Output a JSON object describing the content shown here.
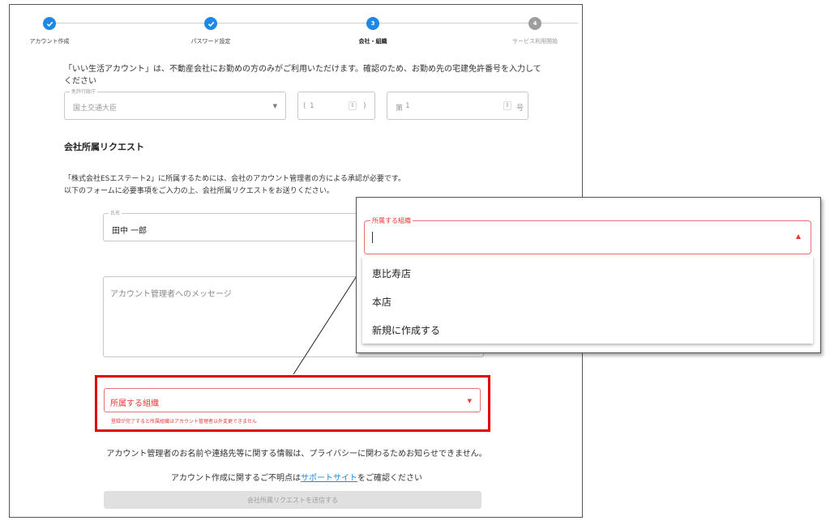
{
  "stepper": {
    "steps": [
      {
        "number": "1",
        "label": "アカウント作成",
        "state": "done"
      },
      {
        "number": "2",
        "label": "パスワード設定",
        "state": "done"
      },
      {
        "number": "3",
        "label": "会社・組織",
        "state": "active"
      },
      {
        "number": "4",
        "label": "サービス利用開始",
        "state": "todo"
      }
    ]
  },
  "intro": {
    "text": "「いい生活アカウント」は、不動産会社にお勤めの方のみがご利用いただけます。確認のため、お勤め先の宅建免許番号を入力してください"
  },
  "license": {
    "issuer_legend": "免許行政庁",
    "issuer_value": "国土交通大臣",
    "renewal_value": "1",
    "renewal_open": "(",
    "renewal_close": ")",
    "number_prefix": "第",
    "number_value": "1",
    "number_suffix": "号"
  },
  "section": {
    "title": "会社所属リクエスト",
    "notice_line1": "「株式会社ESエステート2」に所属するためには、会社のアカウント管理者の方による承認が必要です。",
    "notice_line2": "以下のフォームに必要事項をご入力の上、会社所属リクエストをお送りください。"
  },
  "form": {
    "name_legend": "氏名",
    "name_value": "田中 一郎",
    "message_placeholder": "アカウント管理者へのメッセージ",
    "org_label": "所属する組織",
    "org_help": "登録が完了すると所属組織はアカウント管理者以外変更できません",
    "privacy_note": "アカウント管理者のお名前や連絡先等に関する情報は、プライバシーに関わるためお知らせできません。",
    "support_prefix": "アカウント作成に関するご不明点は",
    "support_link": "サポートサイト",
    "support_suffix": "をご確認ください",
    "submit_label": "会社所属リクエストを送信する"
  },
  "zoom": {
    "org_legend": "所属する組織",
    "options": [
      "恵比寿店",
      "本店",
      "新規に作成する"
    ]
  },
  "colors": {
    "accent": "#1e88e5",
    "error": "#e53935",
    "highlight": "#e00000"
  }
}
